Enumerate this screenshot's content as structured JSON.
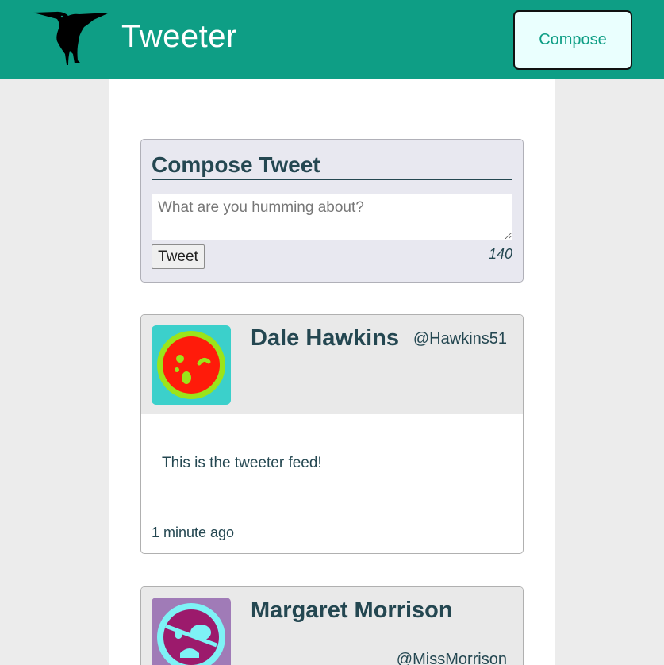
{
  "header": {
    "brand": "Tweeter",
    "compose_label": "Compose",
    "logo_icon": "hummingbird-icon"
  },
  "composer": {
    "title": "Compose Tweet",
    "placeholder": "What are you humming about?",
    "submit_label": "Tweet",
    "char_count": "140"
  },
  "tweets": [
    {
      "name": "Dale Hawkins",
      "handle": "@Hawkins51",
      "body": "This is the tweeter feed!",
      "time": "1 minute ago",
      "avatar_icon": "avatar-winking-face-icon",
      "avatar_colors": {
        "bg": "#3bd0cb",
        "ring": "#9be41a",
        "face": "#ff1b0a"
      }
    },
    {
      "name": "Margaret Morrison",
      "handle": "@MissMorrison",
      "avatar_icon": "avatar-pirate-face-icon",
      "avatar_colors": {
        "bg": "#a07bb7",
        "ring": "#7ef2f6",
        "face": "#9c1a6c"
      }
    }
  ],
  "colors": {
    "accent": "#0e9e85",
    "text": "#244751",
    "page_bg": "#ececec"
  }
}
